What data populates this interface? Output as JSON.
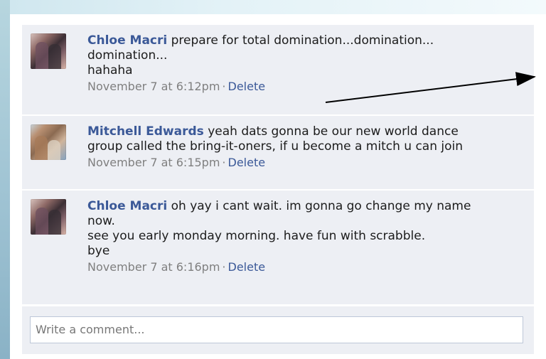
{
  "comments": [
    {
      "author": "Chloe Macri",
      "text": " prepare for total domination...domination...\ndomination...\nhahaha",
      "date": "November 7 at 6:12pm",
      "separator": "·",
      "action": "Delete",
      "avatar": "profile-photo"
    },
    {
      "author": "Mitchell Edwards",
      "text": " yeah dats gonna be our new world dance\ngroup called the bring-it-oners, if u become a mitch u can join",
      "date": "November 7 at 6:15pm",
      "separator": "·",
      "action": "Delete",
      "avatar": "profile-photo"
    },
    {
      "author": "Chloe Macri",
      "text": " oh yay i cant wait. im gonna go change my name\nnow.\nsee you early monday morning. have fun with scrabble.\nbye",
      "date": "November 7 at 6:16pm",
      "separator": "·",
      "action": "Delete",
      "avatar": "profile-photo"
    }
  ],
  "composer": {
    "placeholder": "Write a comment..."
  },
  "colors": {
    "link": "#3b5998",
    "comment_bg": "#edeff4",
    "meta": "#7f7f7f",
    "arrow": "#000000"
  },
  "icons": {
    "arrow": "arrow-icon"
  }
}
